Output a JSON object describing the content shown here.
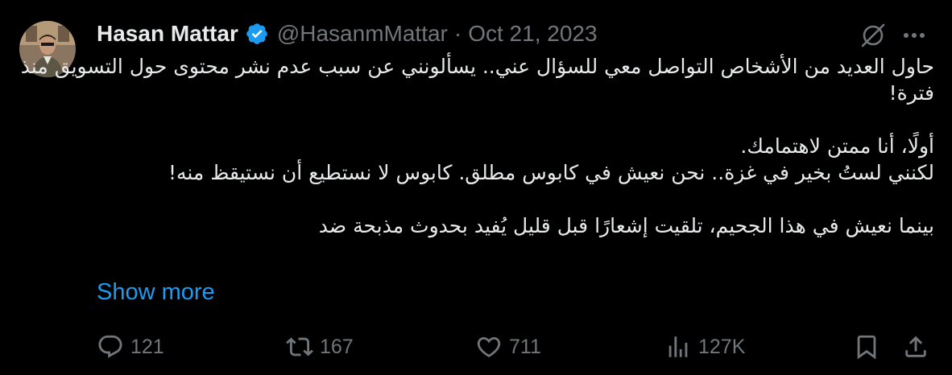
{
  "author": {
    "name": "Hasan Mattar",
    "handle": "@HasanmMattar",
    "separator": "·",
    "date": "Oct 21, 2023"
  },
  "tweet": {
    "lines": [
      "حاول العديد من الأشخاص التواصل معي للسؤال عني.. يسألونني عن سبب عدم نشر محتوى حول التسويق منذ",
      "فترة!",
      "",
      "أولًا، أنا ممتن لاهتمامك.",
      "لكنني لستُ  بخير في غزة.. نحن نعيش في كابوس مطلق. كابوس لا نستطيع أن نستيقظ منه!",
      "",
      "بينما نعيش في هذا الجحيم، تلقيت إشعارًا قبل قليل يُفيد بحدوث مذبحة ضد"
    ],
    "show_more": "Show more"
  },
  "actions": {
    "replies": "121",
    "reposts": "167",
    "likes": "711",
    "views": "127K"
  },
  "icons": {
    "verified": "verified-badge-icon",
    "grok": "grok-icon",
    "more": "more-icon",
    "reply": "reply-icon",
    "repost": "repost-icon",
    "like": "like-icon",
    "views": "views-icon",
    "bookmark": "bookmark-icon",
    "share": "share-icon"
  },
  "colors": {
    "background": "#000000",
    "text": "#e7e9ea",
    "secondary": "#71767b",
    "accent": "#1d9bf0"
  }
}
